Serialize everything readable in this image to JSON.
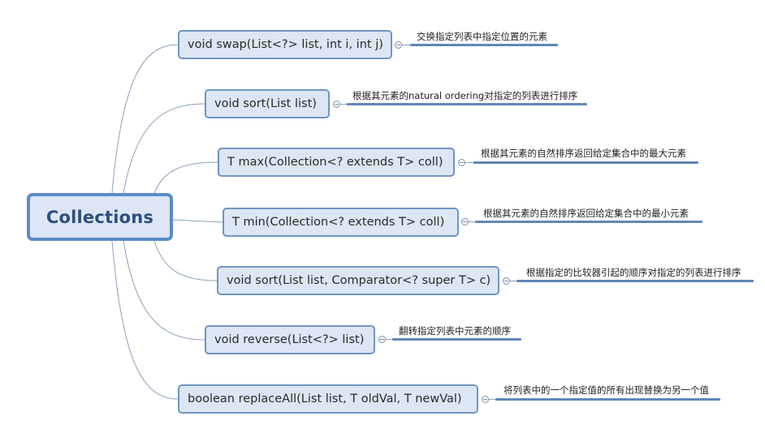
{
  "root": {
    "label": "Collections",
    "icon": "none"
  },
  "colors": {
    "node_fill": "#dce6f4",
    "node_border": "#6f95c4",
    "root_border": "#5b8cc8",
    "root_text": "#2e4f7c",
    "connector": "#8aa0bb",
    "note_underline": "#5f87b8"
  },
  "branches": [
    {
      "label": "void swap(List<?>  list, int i, int j)",
      "note": "交换指定列表中指定位置的元素"
    },
    {
      "label": "void sort(List list)",
      "note": "根据其元素的natural ordering对指定的列表进行排序"
    },
    {
      "label": "T max(Collection<? extends T>  coll)",
      "note": "根据其元素的自然排序返回给定集合中的最大元素"
    },
    {
      "label": "T min(Collection<? extends T> coll)",
      "note": "根据其元素的自然排序返回给定集合中的最小元素"
    },
    {
      "label": "void sort(List list, Comparator<? super T> c)",
      "note": "根据指定的比较器引起的顺序对指定的列表进行排序"
    },
    {
      "label": "void reverse(List<?> list)",
      "note": "翻转指定列表中元素的顺序"
    },
    {
      "label": "boolean replaceAll(List list, T oldVal, T newVal)",
      "note": "将列表中的一个指定值的所有出现替换为另一个值"
    }
  ]
}
